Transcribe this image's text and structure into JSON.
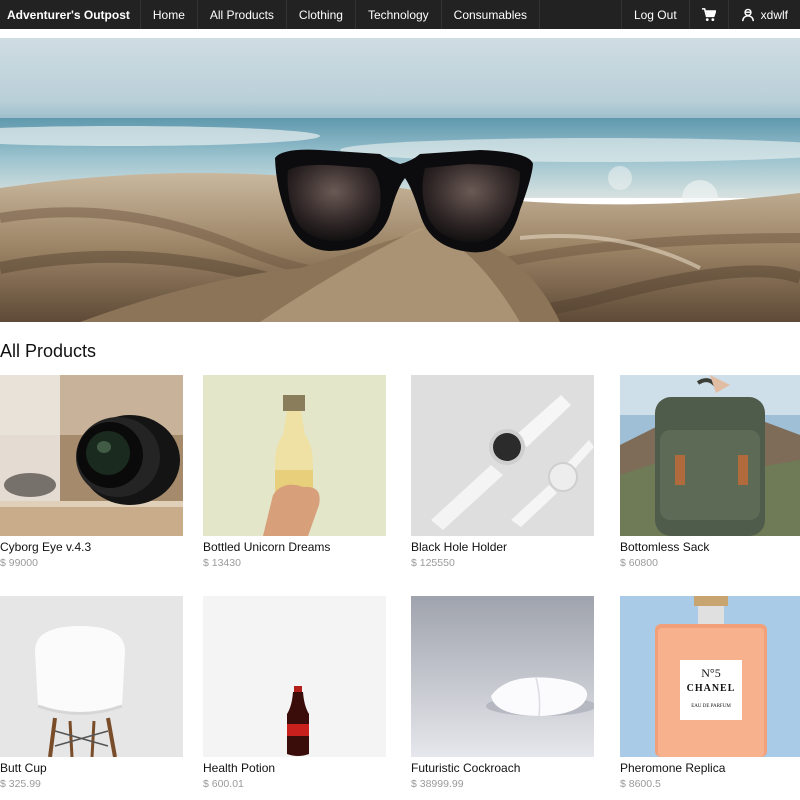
{
  "nav": {
    "brand": "Adventurer's Outpost",
    "links": [
      "Home",
      "All Products",
      "Clothing",
      "Technology",
      "Consumables"
    ],
    "logout": "Log Out",
    "user": "xdwlf"
  },
  "section_title": "All Products",
  "products": [
    {
      "name": "Cyborg Eye v.4.3",
      "price": "$ 99000"
    },
    {
      "name": "Bottled Unicorn Dreams",
      "price": "$ 13430"
    },
    {
      "name": "Black Hole Holder",
      "price": "$ 125550"
    },
    {
      "name": "Bottomless Sack",
      "price": "$ 60800"
    },
    {
      "name": "Butt Cup",
      "price": "$ 325.99"
    },
    {
      "name": "Health Potion",
      "price": "$ 600.01"
    },
    {
      "name": "Futuristic Cockroach",
      "price": "$ 38999.99"
    },
    {
      "name": "Pheromone Replica",
      "price": "$ 8600.5"
    }
  ],
  "perfume_label": {
    "line1": "N°5",
    "line2": "CHANEL",
    "line3": "EAU DE PARFUM"
  },
  "icons": {
    "cart": "cart-icon",
    "user": "user-icon"
  }
}
